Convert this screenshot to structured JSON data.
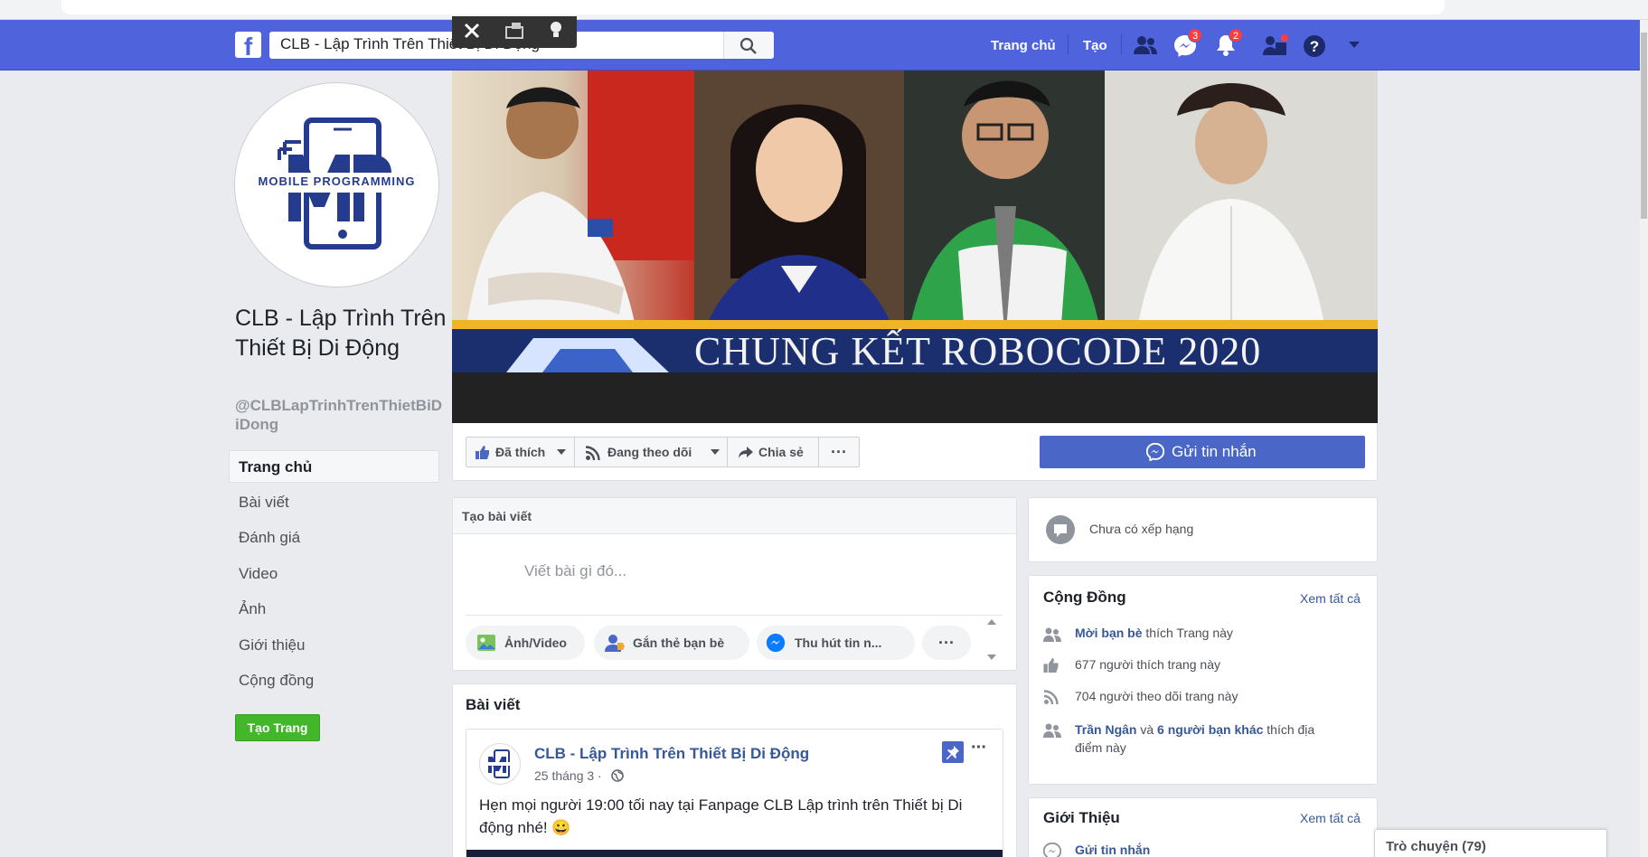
{
  "topbar": {
    "search_value": "CLB - Lập Trình Trên Thiết Bị Di Động",
    "home": "Trang chủ",
    "create": "Tạo",
    "messenger_badge": "3",
    "notifications_badge": "2"
  },
  "page": {
    "name": "CLB - Lập Trình Trên Thiết Bị Di Động",
    "handle": "@CLBLapTrinhTrenThietBiDiDong",
    "logo_text": "MOBILE PROGRAMMING"
  },
  "leftnav": {
    "items": [
      "Trang chủ",
      "Bài viết",
      "Đánh giá",
      "Video",
      "Ảnh",
      "Giới thiệu",
      "Cộng đồng"
    ],
    "create_page": "Tạo Trang"
  },
  "cover": {
    "banner_text": "CHUNG KẾT ROBOCODE 2020"
  },
  "actions": {
    "liked": "Đã thích",
    "following": "Đang theo dõi",
    "share": "Chia sẻ",
    "more": "···",
    "send_message": "Gửi tin nhắn"
  },
  "composer": {
    "header": "Tạo bài viết",
    "placeholder": "Viết bài gì đó...",
    "photo_video": "Ảnh/Video",
    "tag_friends": "Gắn thẻ bạn bè",
    "get_messages": "Thu hút tin n...",
    "more": "···"
  },
  "posts": {
    "header": "Bài viết",
    "author": "CLB - Lập Trình Trên Thiết Bị Di Động",
    "date": "25 tháng 3 ·",
    "text": "Hẹn mọi người 19:00 tối nay tại Fanpage CLB Lập trình trên Thiết bị Di động nhé! 😀"
  },
  "rating": {
    "text": "Chưa có xếp hạng"
  },
  "community": {
    "title": "Cộng Đồng",
    "see_all": "Xem tất cả",
    "invite_link": "Mời bạn bè",
    "invite_rest": "thích Trang này",
    "likes": "677 người thích trang này",
    "follows": "704 người theo dõi trang này",
    "friend_name": "Trần Ngân",
    "friend_and": "và",
    "friend_others": "6 người bạn khác",
    "friend_rest_1": "thích địa",
    "friend_rest_2": "điểm này"
  },
  "about": {
    "title": "Giới Thiệu",
    "see_all": "Xem tất cả",
    "send_message": "Gửi tin nhắn"
  },
  "chat": {
    "label": "Trò chuyện (79)"
  },
  "colors": {
    "fb_blue": "#4f63dd",
    "link": "#365899",
    "green": "#42b72a"
  }
}
